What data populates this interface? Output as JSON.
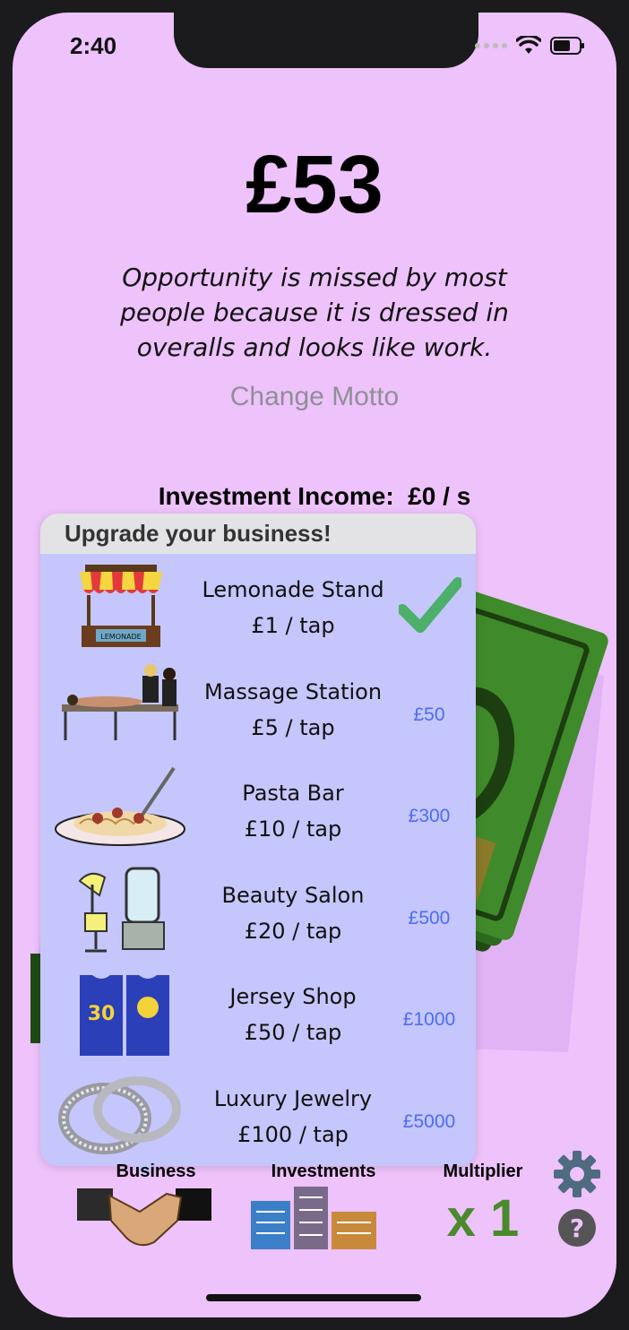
{
  "status": {
    "time": "2:40"
  },
  "balance": "£53",
  "motto": "Opportunity is missed by most people because it is dressed in overalls and looks like work.",
  "change_motto_label": "Change Motto",
  "income": {
    "label": "Investment Income:",
    "value": "£0 / s"
  },
  "upgrade_popover": {
    "title": "Upgrade your business!",
    "items": [
      {
        "name": "Lemonade Stand",
        "rate": "£1 / tap",
        "price": "",
        "owned": true,
        "icon": "lemonade-stand-icon"
      },
      {
        "name": "Massage Station",
        "rate": "£5 / tap",
        "price": "£50",
        "owned": false,
        "icon": "massage-table-icon"
      },
      {
        "name": "Pasta Bar",
        "rate": "£10 / tap",
        "price": "£300",
        "owned": false,
        "icon": "pasta-plate-icon"
      },
      {
        "name": "Beauty Salon",
        "rate": "£20 / tap",
        "price": "£500",
        "owned": false,
        "icon": "salon-chair-icon"
      },
      {
        "name": "Jersey Shop",
        "rate": "£50 / tap",
        "price": "£1000",
        "owned": false,
        "icon": "jersey-icon"
      },
      {
        "name": "Luxury Jewelry",
        "rate": "£100 / tap",
        "price": "£5000",
        "owned": false,
        "icon": "rings-icon"
      }
    ],
    "lemonade_sign": "LEMONADE"
  },
  "tabs": {
    "business": "Business",
    "investments": "Investments",
    "multiplier": "Multiplier",
    "multiplier_value": "x 1"
  },
  "colors": {
    "background": "#eec2fb",
    "popover": "#c5c6fb",
    "price": "#4c6df0",
    "check": "#4caf6a",
    "multiplier": "#4a8a2c"
  }
}
